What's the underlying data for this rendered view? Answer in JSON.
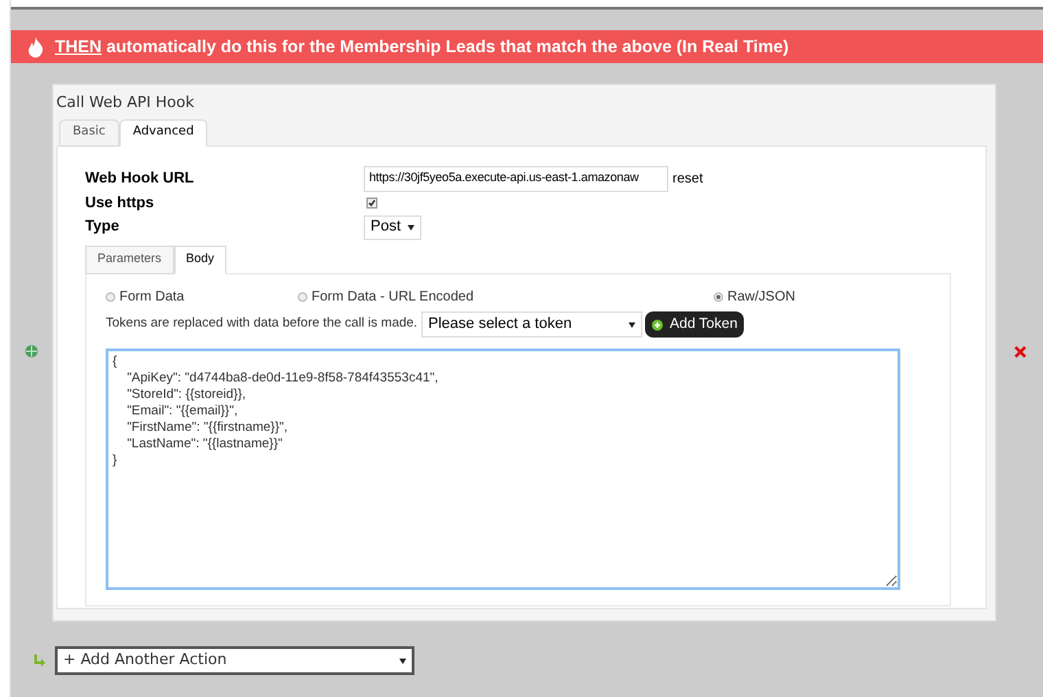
{
  "banner": {
    "lead": "THEN",
    "text": "automatically do this for the Membership Leads that match the above (In Real Time)"
  },
  "action": {
    "title": "Call Web API Hook",
    "tabs": [
      {
        "label": "Basic",
        "selected": false
      },
      {
        "label": "Advanced",
        "selected": true
      }
    ],
    "url_label": "Web Hook URL",
    "url_value": "https://30jf5yeo5a.execute-api.us-east-1.amazonaw",
    "reset": "reset",
    "https_label": "Use https",
    "https_checked": true,
    "type_label": "Type",
    "type_value": "Post",
    "body_tabs": [
      {
        "label": "Parameters",
        "selected": false
      },
      {
        "label": "Body",
        "selected": true
      }
    ],
    "formats": [
      {
        "label": "Form Data",
        "selected": false
      },
      {
        "label": "Form Data - URL Encoded",
        "selected": false
      },
      {
        "label": "Raw/JSON",
        "selected": true
      }
    ],
    "tokens_note": "Tokens are replaced with data before the call is made.",
    "token_select": "Please select a token",
    "add_token": "Add Token",
    "body_lines": [
      "{",
      "    \"ApiKey\": \"d4744ba8-de0d-11e9-8f58-784f43553c41\",",
      "    \"StoreId\": {{storeid}},",
      "    \"Email\": \"{{email}}\",",
      "    \"FirstName\": \"{{firstname}}\",",
      "    \"LastName\": \"{{lastname}}\"",
      "}"
    ]
  },
  "add_action": "+ Add Another Action"
}
